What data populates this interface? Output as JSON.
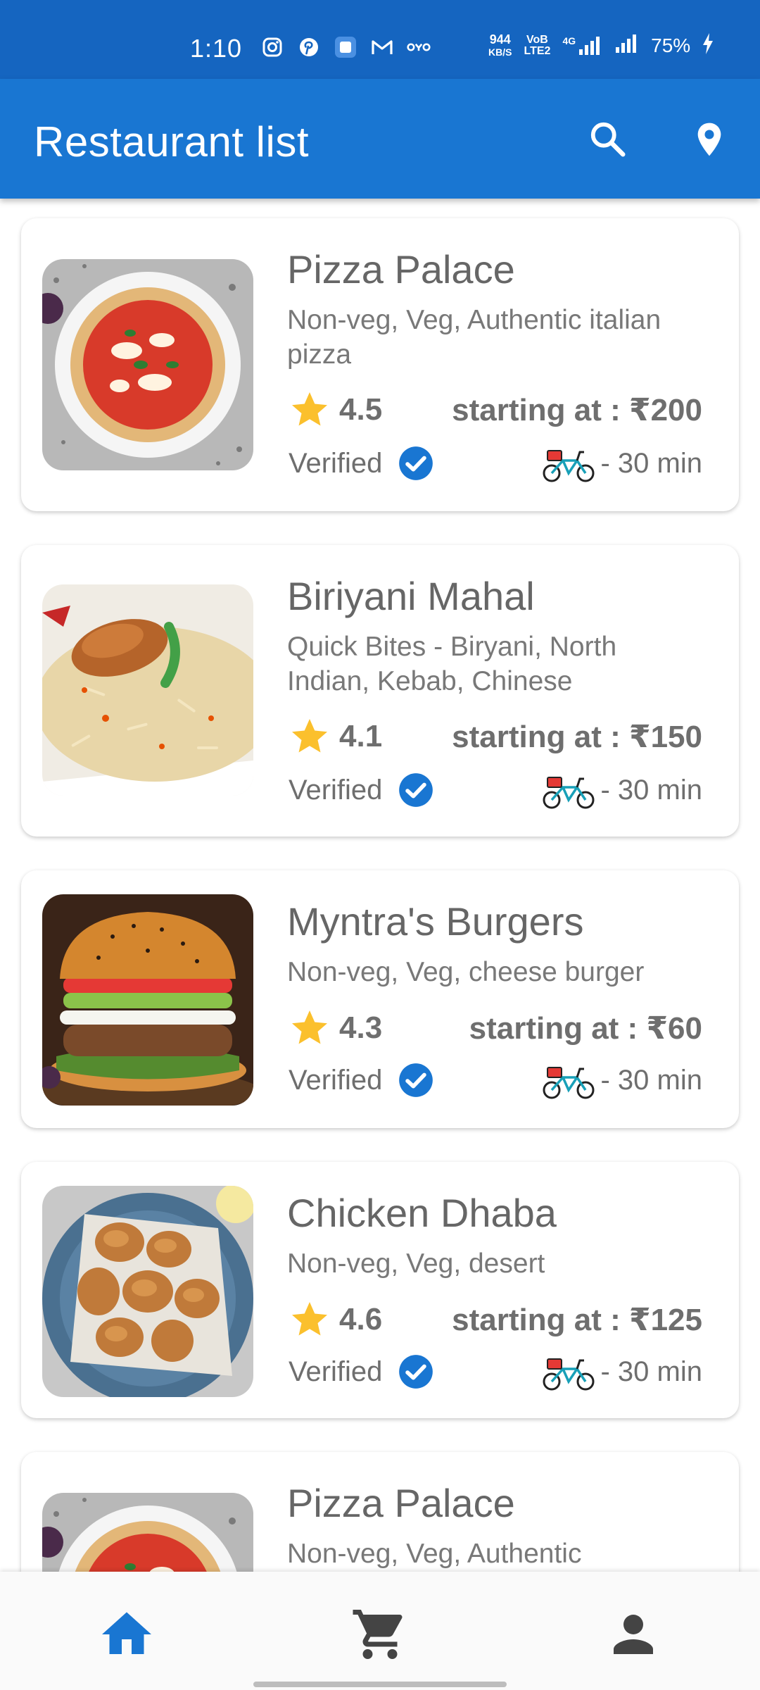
{
  "status_bar": {
    "time": "1:10",
    "speed_value": "944",
    "speed_unit": "KB/S",
    "volte": "VoB LTE2",
    "network": "4G",
    "battery": "75%",
    "left_icons": [
      "instagram-icon",
      "pinterest-icon",
      "app-icon",
      "gmail-icon",
      "oyo-icon"
    ]
  },
  "app_bar": {
    "title": "Restaurant list",
    "background": "#1976d2",
    "actions": [
      "search-icon",
      "location-pin-icon"
    ]
  },
  "restaurants": [
    {
      "name": "Pizza Palace",
      "description": "Non-veg, Veg, Authentic italian pizza",
      "rating": "4.5",
      "price": "starting at : ₹200",
      "verified_label": "Verified",
      "delivery_time": "- 30 min",
      "image": "pizza"
    },
    {
      "name": "Biriyani Mahal",
      "description": "Quick Bites - Biryani, North Indian, Kebab, Chinese",
      "rating": "4.1",
      "price": "starting at : ₹150",
      "verified_label": "Verified",
      "delivery_time": "- 30 min",
      "image": "biryani"
    },
    {
      "name": "Myntra's Burgers",
      "description": "Non-veg, Veg, cheese burger",
      "rating": "4.3",
      "price": "starting at : ₹60",
      "verified_label": "Verified",
      "delivery_time": "- 30 min",
      "image": "burger"
    },
    {
      "name": "Chicken Dhaba",
      "description": "Non-veg, Veg, desert",
      "rating": "4.6",
      "price": "starting at : ₹125",
      "verified_label": "Verified",
      "delivery_time": "- 30 min",
      "image": "fried-chicken"
    },
    {
      "name": "Pizza Palace",
      "description": "Non-veg, Veg, Authentic",
      "image": "pizza"
    }
  ],
  "bottom_nav": {
    "items": [
      "home-icon",
      "cart-icon",
      "profile-icon"
    ],
    "active": "home-icon",
    "active_color": "#1976d2",
    "inactive_color": "#444444"
  },
  "colors": {
    "status_bar": "#1565c0",
    "star": "#fbc02d",
    "verified_badge": "#1976d2"
  }
}
